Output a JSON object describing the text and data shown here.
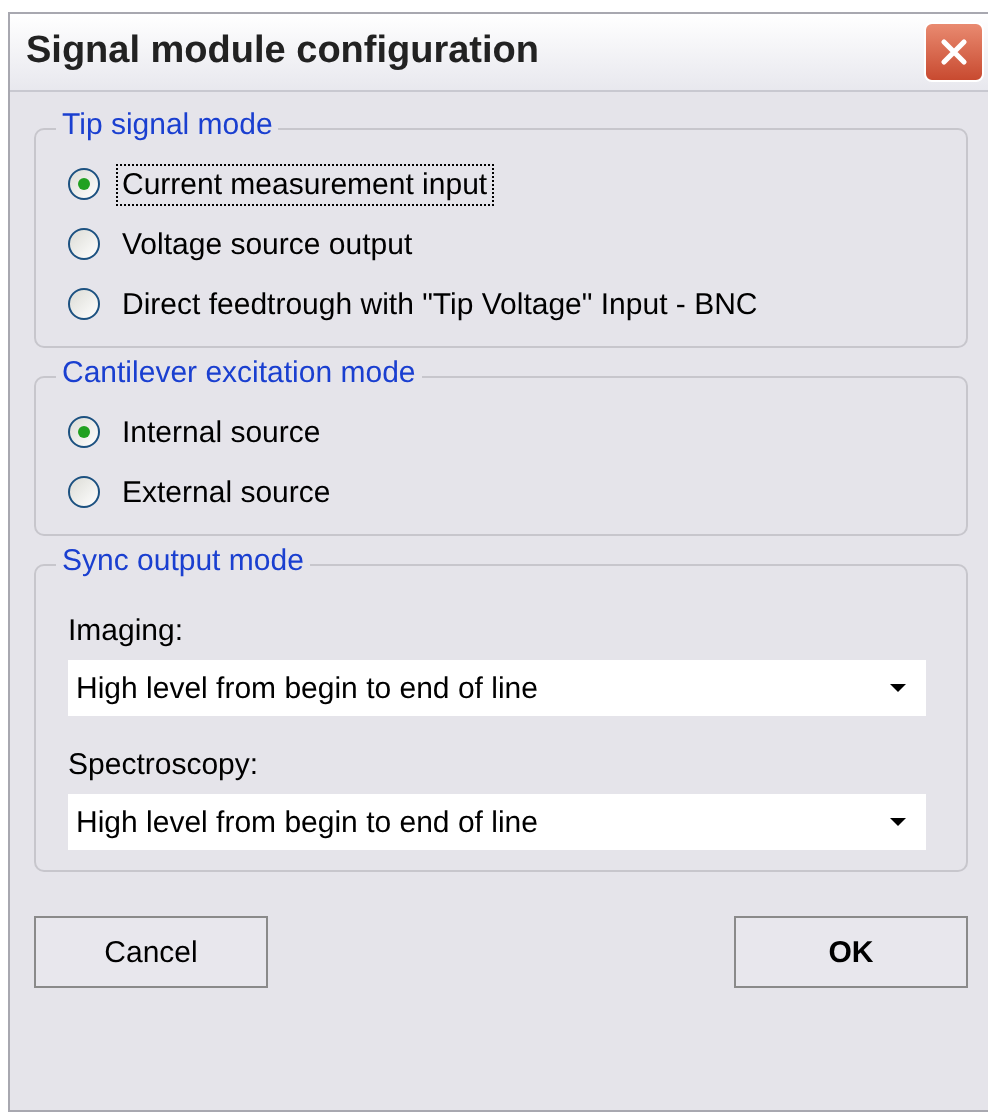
{
  "window": {
    "title": "Signal module configuration"
  },
  "groups": [
    {
      "kind": "radio",
      "title": "Tip signal mode",
      "options": [
        {
          "label": "Current measurement input",
          "selected": true,
          "focused": true
        },
        {
          "label": "Voltage source output",
          "selected": false,
          "focused": false
        },
        {
          "label": "Direct feedtrough with \"Tip Voltage\" Input - BNC",
          "selected": false,
          "focused": false
        }
      ]
    },
    {
      "kind": "radio",
      "title": "Cantilever excitation mode",
      "options": [
        {
          "label": "Internal source",
          "selected": true,
          "focused": false
        },
        {
          "label": "External source",
          "selected": false,
          "focused": false
        }
      ]
    },
    {
      "kind": "dropdowns",
      "title": "Sync output mode",
      "fields": [
        {
          "label": "Imaging:",
          "value": "High level from begin to end of line"
        },
        {
          "label": "Spectroscopy:",
          "value": "High level from begin to end of line"
        }
      ]
    }
  ],
  "buttons": [
    {
      "label": "Cancel",
      "kind": "normal"
    },
    {
      "label": "OK",
      "kind": "default"
    }
  ]
}
